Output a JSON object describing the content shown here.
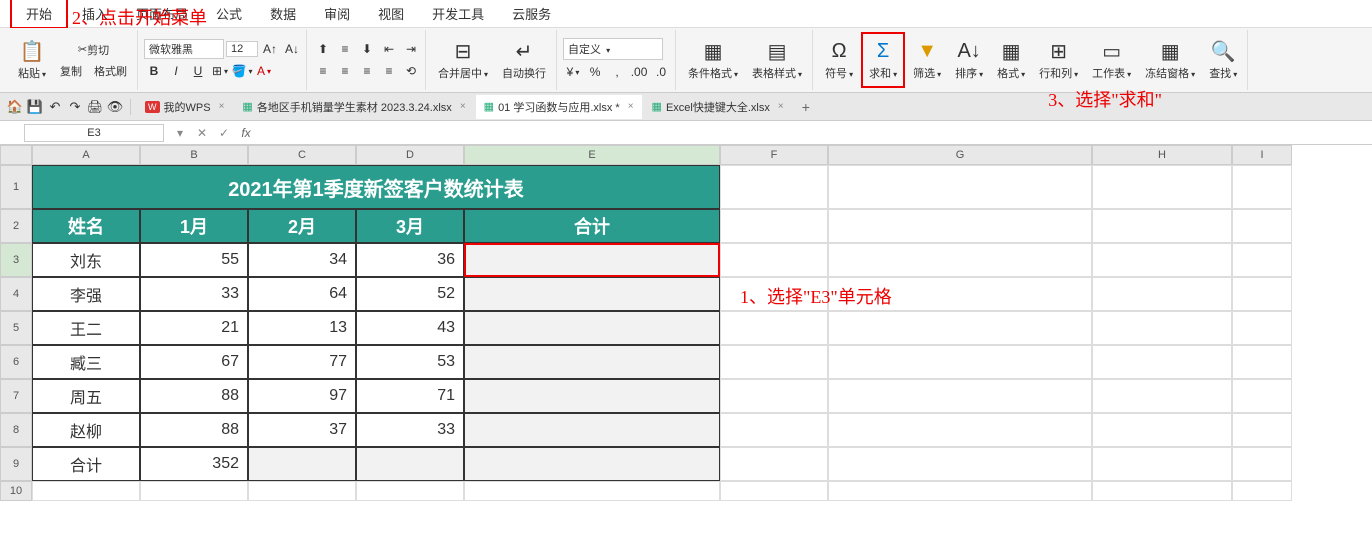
{
  "menu": {
    "items": [
      "开始",
      "插入",
      "页面布局",
      "公式",
      "数据",
      "审阅",
      "视图",
      "开发工具",
      "云服务"
    ]
  },
  "ribbon": {
    "paste": "粘贴",
    "cut": "剪切",
    "copy": "复制",
    "format_painter": "格式刷",
    "font_name": "微软雅黑",
    "font_size": "12",
    "merge_center": "合并居中",
    "wrap_text": "自动换行",
    "number_format": "自定义",
    "cond_format": "条件格式",
    "table_style": "表格样式",
    "symbol": "符号",
    "sum": "求和",
    "filter": "筛选",
    "sort": "排序",
    "format": "格式",
    "row_col": "行和列",
    "worksheet": "工作表",
    "freeze": "冻结窗格",
    "find": "查找"
  },
  "doc_tabs": {
    "wps": "我的WPS",
    "tab1": "各地区手机销量学生素材 2023.3.24.xlsx",
    "tab2": "01 学习函数与应用.xlsx *",
    "tab3": "Excel快捷键大全.xlsx"
  },
  "name_box": "E3",
  "fx": "fx",
  "cols": [
    "A",
    "B",
    "C",
    "D",
    "E",
    "F",
    "G",
    "H",
    "I"
  ],
  "table": {
    "title": "2021年第1季度新签客户数统计表",
    "headers": [
      "姓名",
      "1月",
      "2月",
      "3月",
      "合计"
    ],
    "rows": [
      {
        "name": "刘东",
        "m1": "55",
        "m2": "34",
        "m3": "36",
        "total": ""
      },
      {
        "name": "李强",
        "m1": "33",
        "m2": "64",
        "m3": "52",
        "total": ""
      },
      {
        "name": "王二",
        "m1": "21",
        "m2": "13",
        "m3": "43",
        "total": ""
      },
      {
        "name": "臧三",
        "m1": "67",
        "m2": "77",
        "m3": "53",
        "total": ""
      },
      {
        "name": "周五",
        "m1": "88",
        "m2": "97",
        "m3": "71",
        "total": ""
      },
      {
        "name": "赵柳",
        "m1": "88",
        "m2": "37",
        "m3": "33",
        "total": ""
      }
    ],
    "sum_row": {
      "name": "合计",
      "m1": "352",
      "m2": "",
      "m3": "",
      "total": ""
    }
  },
  "annotations": {
    "a1": "1、选择\"E3\"单元格",
    "a2": "2、点击开始菜单",
    "a3": "3、选择\"求和\""
  }
}
